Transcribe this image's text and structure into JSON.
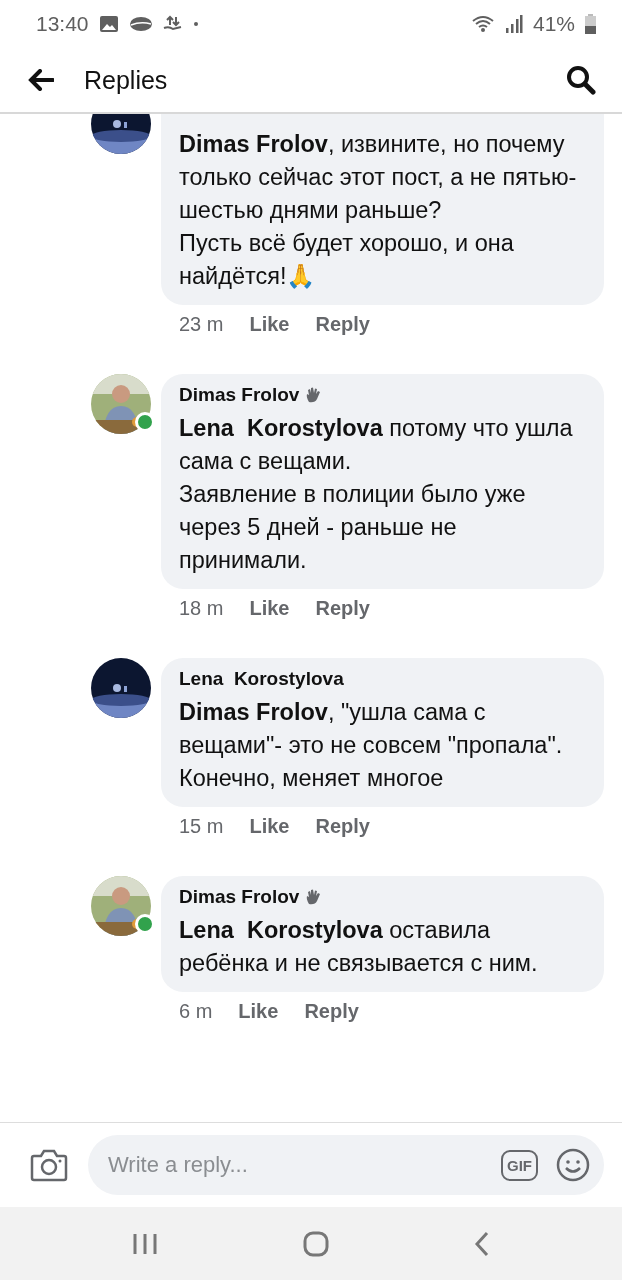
{
  "status_bar": {
    "time": "13:40",
    "battery": "41%"
  },
  "header": {
    "title": "Replies"
  },
  "comments": [
    {
      "badge": false,
      "online": false,
      "text": "**Dimas Frolov**, извините, но почему только сейчас этот пост, а не пятью-шестью днями раньше?\nПусть всё будет хорошо, и она найдётся!🙏",
      "time": "23 m",
      "like": "Like",
      "reply": "Reply",
      "kind": "cut"
    },
    {
      "author": "Dimas Frolov",
      "badge": true,
      "online": true,
      "text": "**Lena  Korostylova** потому что ушла сама с вещами.\nЗаявление в полиции было уже через 5 дней - раньше не принимали.",
      "time": "18 m",
      "like": "Like",
      "reply": "Reply",
      "kind": "full"
    },
    {
      "author": "Lena  Korostylova",
      "badge": false,
      "online": false,
      "text": "**Dimas Frolov**, \"ушла сама с вещами\"- это не совсем \"пропала\". Конечно, меняет многое",
      "time": "15 m",
      "like": "Like",
      "reply": "Reply",
      "kind": "full"
    },
    {
      "author": "Dimas Frolov",
      "badge": true,
      "online": true,
      "text": "**Lena  Korostylova** оставила ребёнка и не связывается с ним.",
      "time": "6 m",
      "like": "Like",
      "reply": "Reply",
      "kind": "full"
    }
  ],
  "composer": {
    "placeholder": "Write a reply...",
    "gif_label": "GIF"
  }
}
